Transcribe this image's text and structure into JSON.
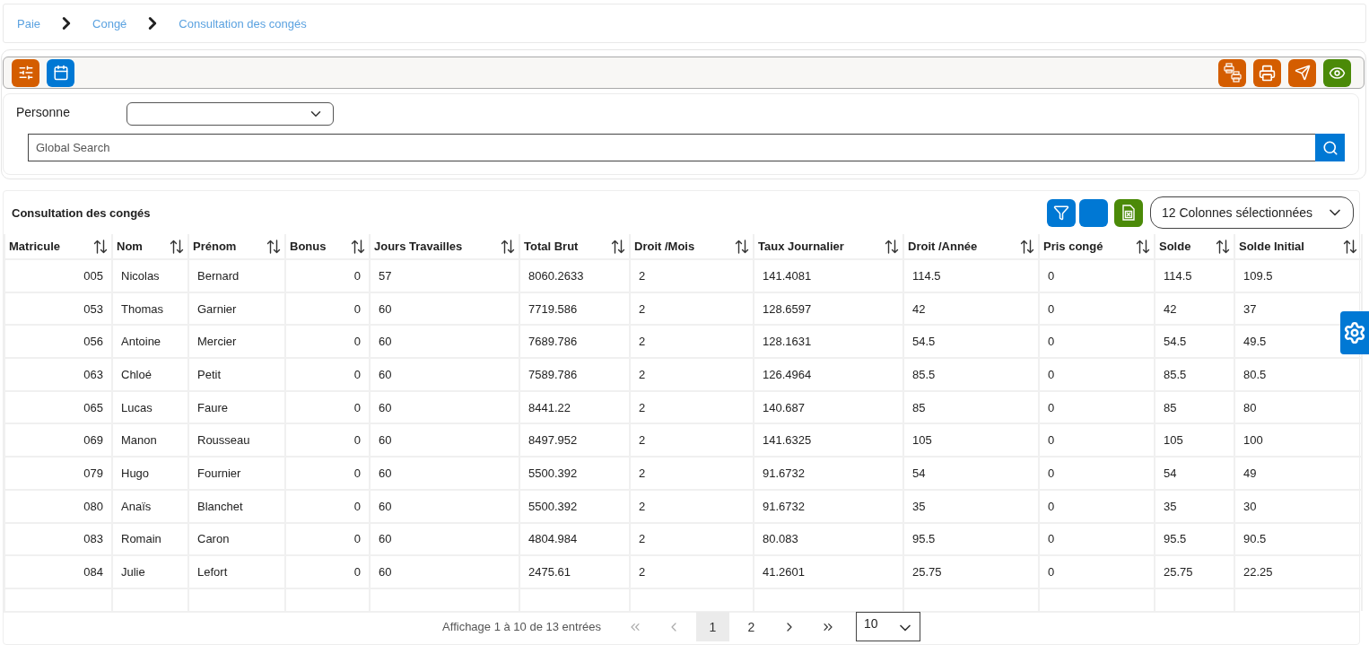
{
  "breadcrumb": [
    "Paie",
    "Congé",
    "Consultation des congés"
  ],
  "toolbar": {
    "left": [
      {
        "kind": "sliders",
        "color": "#d45d00"
      },
      {
        "kind": "calendar",
        "color": "#0078d4"
      }
    ],
    "right": [
      {
        "kind": "printers",
        "color": "#d45d00"
      },
      {
        "kind": "printer",
        "color": "#d45d00"
      },
      {
        "kind": "send",
        "color": "#d45d00"
      },
      {
        "kind": "eye",
        "color": "#4b8a08"
      }
    ]
  },
  "filters": {
    "personne": {
      "label": "Personne"
    },
    "search": {
      "placeholder": "Global Search"
    }
  },
  "table": {
    "title": "Consultation des congés",
    "actions": [
      {
        "kind": "filter",
        "color": "#0078d4"
      },
      {
        "kind": "blank",
        "color": "#0078d4"
      },
      {
        "kind": "excel",
        "color": "#4b8a08"
      }
    ],
    "column_picker": {
      "value": "12 Colonnes sélectionnées"
    },
    "columns": [
      "Matricule",
      "Nom",
      "Prénom",
      "Bonus",
      "Jours Travailles",
      "Total Brut",
      "Droit /Mois",
      "Taux Journalier",
      "Droit /Année",
      "Pris congé",
      "Solde",
      "Solde Initial"
    ],
    "rows": [
      [
        "005",
        "Nicolas",
        "Bernard",
        "0",
        "57",
        "8060.2633",
        "2",
        "141.4081",
        "114.5",
        "0",
        "114.5",
        "109.5"
      ],
      [
        "053",
        "Thomas",
        "Garnier",
        "0",
        "60",
        "7719.586",
        "2",
        "128.6597",
        "42",
        "0",
        "42",
        "37"
      ],
      [
        "056",
        "Antoine",
        "Mercier",
        "0",
        "60",
        "7689.786",
        "2",
        "128.1631",
        "54.5",
        "0",
        "54.5",
        "49.5"
      ],
      [
        "063",
        "Chloé",
        "Petit",
        "0",
        "60",
        "7589.786",
        "2",
        "126.4964",
        "85.5",
        "0",
        "85.5",
        "80.5"
      ],
      [
        "065",
        "Lucas",
        "Faure",
        "0",
        "60",
        "8441.22",
        "2",
        "140.687",
        "85",
        "0",
        "85",
        "80"
      ],
      [
        "069",
        "Manon",
        "Rousseau",
        "0",
        "60",
        "8497.952",
        "2",
        "141.6325",
        "105",
        "0",
        "105",
        "100"
      ],
      [
        "079",
        "Hugo",
        "Fournier",
        "0",
        "60",
        "5500.392",
        "2",
        "91.6732",
        "54",
        "0",
        "54",
        "49"
      ],
      [
        "080",
        "Anaïs",
        "Blanchet",
        "0",
        "60",
        "5500.392",
        "2",
        "91.6732",
        "35",
        "0",
        "35",
        "30"
      ],
      [
        "083",
        "Romain",
        "Caron",
        "0",
        "60",
        "4804.984",
        "2",
        "80.083",
        "95.5",
        "0",
        "95.5",
        "90.5"
      ],
      [
        "084",
        "Julie",
        "Lefort",
        "0",
        "60",
        "2475.61",
        "2",
        "41.2601",
        "25.75",
        "0",
        "25.75",
        "22.25"
      ]
    ]
  },
  "pagination": {
    "summary": "Affichage 1 à 10 de 13 entrées",
    "nav_before": [
      {
        "kind": "first",
        "disabled": true
      },
      {
        "kind": "prev",
        "disabled": true
      }
    ],
    "pages": [
      {
        "label": "1",
        "selected": true
      },
      {
        "label": "2",
        "selected": false
      }
    ],
    "nav_after": [
      {
        "kind": "next",
        "disabled": false
      },
      {
        "kind": "last",
        "disabled": false
      }
    ],
    "page_size": {
      "value": "10"
    }
  }
}
